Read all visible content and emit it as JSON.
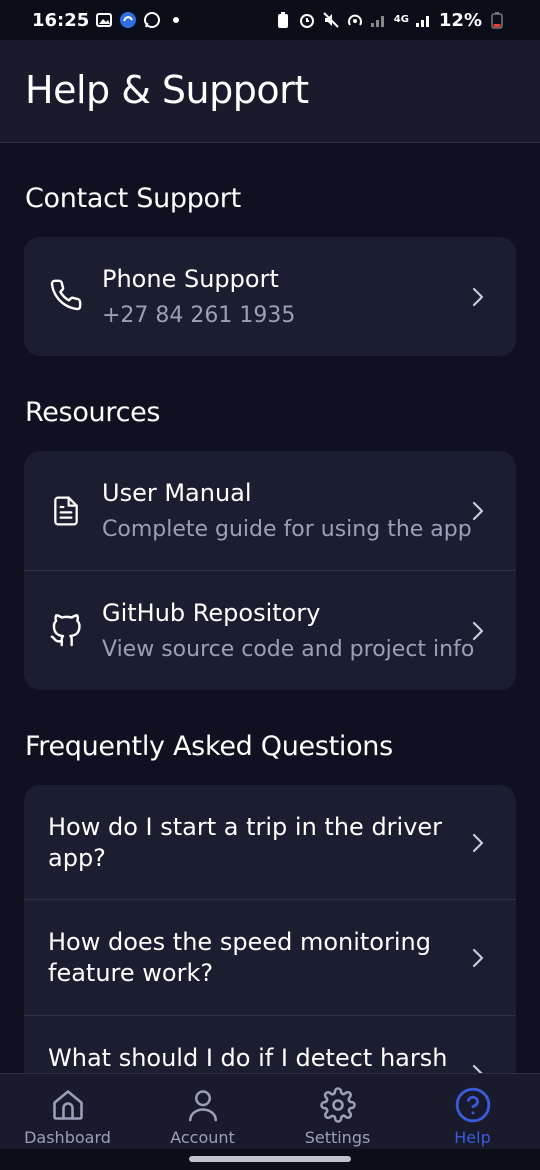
{
  "status_bar": {
    "time": "16:25",
    "battery": "12%",
    "network": "4G"
  },
  "header": {
    "title": "Help & Support"
  },
  "contact": {
    "section_title": "Contact Support",
    "phone": {
      "title": "Phone Support",
      "subtitle": "+27 84 261 1935",
      "icon": "phone-icon"
    }
  },
  "resources": {
    "section_title": "Resources",
    "items": [
      {
        "title": "User Manual",
        "subtitle": "Complete guide for using the app",
        "icon": "document-icon"
      },
      {
        "title": "GitHub Repository",
        "subtitle": "View source code and project info",
        "icon": "github-icon"
      }
    ]
  },
  "faq": {
    "section_title": "Frequently Asked Questions",
    "items": [
      {
        "question": "How do I start a trip in the driver app?"
      },
      {
        "question": "How does the speed monitoring feature work?"
      },
      {
        "question": "What should I do if I detect harsh"
      }
    ]
  },
  "nav": {
    "items": [
      {
        "label": "Dashboard",
        "icon": "home-icon"
      },
      {
        "label": "Account",
        "icon": "user-icon"
      },
      {
        "label": "Settings",
        "icon": "gear-icon"
      },
      {
        "label": "Help",
        "icon": "help-icon"
      }
    ],
    "active": "Help"
  },
  "colors": {
    "background": "#0f1120",
    "card": "#1b1d30",
    "accent": "#3b5bdb",
    "muted_text": "#9aa0b8"
  }
}
